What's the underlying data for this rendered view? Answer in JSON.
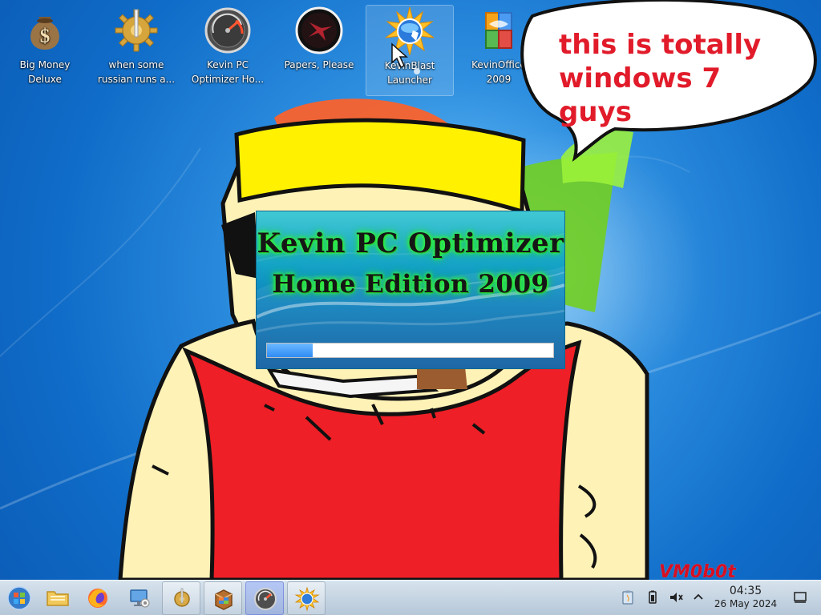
{
  "desktop_icons": [
    {
      "icon": "money-bag-icon",
      "label_line1": "Big Money",
      "label_line2": "Deluxe"
    },
    {
      "icon": "gear-app-icon",
      "label_line1": "when some",
      "label_line2": "russian runs a..."
    },
    {
      "icon": "speedometer-icon",
      "label_line1": "Kevin PC",
      "label_line2": "Optimizer Ho..."
    },
    {
      "icon": "papers-please-icon",
      "label_line1": "Papers, Please",
      "label_line2": ""
    },
    {
      "icon": "kevinblast-icon",
      "label_line1": "KevinBlast",
      "label_line2": "Launcher"
    },
    {
      "icon": "kevinoffice-icon",
      "label_line1": "KevinOffice",
      "label_line2": "2009"
    }
  ],
  "speech_bubble": {
    "text": "this is totally\nwindows 7 guys"
  },
  "splash": {
    "title": "Kevin PC Optimizer",
    "subtitle": "Home Edition 2009",
    "progress": 0.16
  },
  "watermark": "VM0b0t",
  "taskbar": {
    "buttons": [
      {
        "icon": "start-orb-icon"
      },
      {
        "icon": "folder-icon"
      },
      {
        "icon": "firefox-icon"
      },
      {
        "icon": "computer-settings-icon"
      },
      {
        "icon": "gear-app-icon"
      },
      {
        "icon": "installer-box-icon"
      },
      {
        "icon": "speedometer-icon"
      },
      {
        "icon": "globe-app-icon"
      }
    ],
    "tray": [
      {
        "icon": "clipboard-icon"
      },
      {
        "icon": "battery-icon"
      },
      {
        "icon": "volume-muted-icon"
      },
      {
        "icon": "chevron-up-icon"
      }
    ],
    "clock": {
      "time": "04:35",
      "date": "26 May 2024"
    },
    "show_desktop_icon": "show-desktop-icon"
  },
  "colors": {
    "speech_text": "#e11b2a",
    "splash_text": "#161616",
    "splash_glow": "#37ff34",
    "progress_fill": "#2f8cf5",
    "watermark": "#d70f21",
    "taskbar": "#c5d4e2"
  }
}
